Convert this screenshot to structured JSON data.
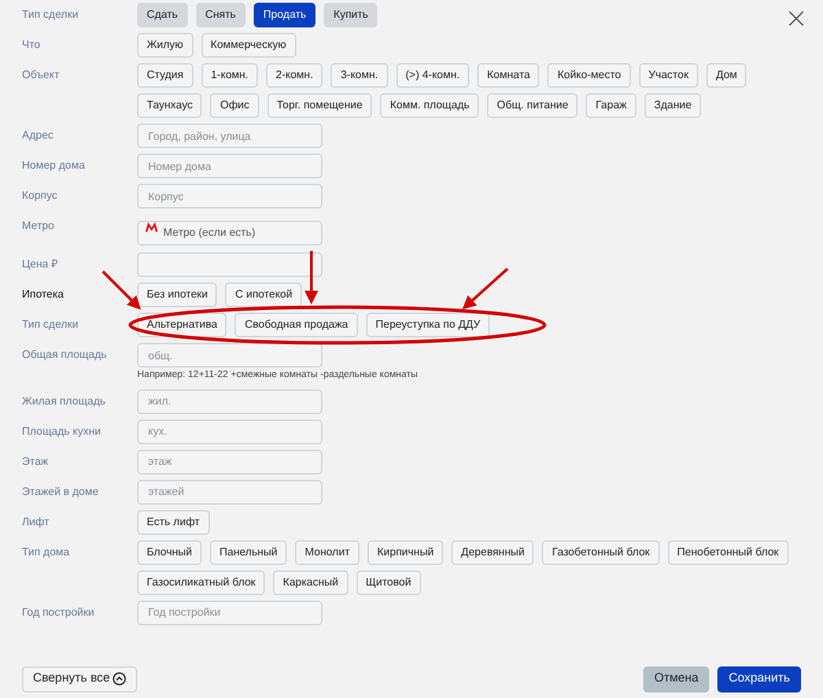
{
  "form": {
    "rows": [
      {
        "kind": "segmented",
        "label": "Тип сделки",
        "label_active": false,
        "options": [
          {
            "label": "Сдать",
            "selected": false
          },
          {
            "label": "Снять",
            "selected": false
          },
          {
            "label": "Продать",
            "selected": true
          },
          {
            "label": "Купить",
            "selected": false
          }
        ]
      },
      {
        "kind": "options",
        "label": "Что",
        "label_active": false,
        "options": [
          {
            "label": "Жилую",
            "selected": false
          },
          {
            "label": "Коммерческую",
            "selected": false
          }
        ]
      },
      {
        "kind": "options",
        "label": "Объект",
        "label_active": false,
        "options": [
          {
            "label": "Студия",
            "selected": false
          },
          {
            "label": "1-комн.",
            "selected": false
          },
          {
            "label": "2-комн.",
            "selected": false
          },
          {
            "label": "3-комн.",
            "selected": false
          },
          {
            "label": "(>) 4-комн.",
            "selected": false
          },
          {
            "label": "Комната",
            "selected": false
          },
          {
            "label": "Койко-место",
            "selected": false
          },
          {
            "label": "Участок",
            "selected": false
          },
          {
            "label": "Дом",
            "selected": false
          },
          {
            "label": "Таунхаус",
            "selected": false
          },
          {
            "label": "Офис",
            "selected": false
          },
          {
            "label": "Торг. помещение",
            "selected": false
          },
          {
            "label": "Комм. площадь",
            "selected": false
          },
          {
            "label": "Общ. питание",
            "selected": false
          },
          {
            "label": "Гараж",
            "selected": false
          },
          {
            "label": "Здание",
            "selected": false
          }
        ]
      },
      {
        "kind": "input",
        "label": "Адрес",
        "label_active": false,
        "placeholder": "Город, район, улица"
      },
      {
        "kind": "input",
        "label": "Номер дома",
        "label_active": false,
        "placeholder": "Номер дома"
      },
      {
        "kind": "input",
        "label": "Корпус",
        "label_active": false,
        "placeholder": "Корпус"
      },
      {
        "kind": "metro",
        "label": "Метро",
        "label_active": false,
        "placeholder": "Метро (если есть)"
      },
      {
        "kind": "input",
        "label": "Цена ₽",
        "label_active": false
      },
      {
        "kind": "options",
        "label": "Ипотека",
        "label_active": true,
        "options": [
          {
            "label": "Без ипотеки",
            "selected": false
          },
          {
            "label": "С ипотекой",
            "selected": false
          }
        ]
      },
      {
        "kind": "callout",
        "label": "Тип сделки",
        "label_active": false,
        "options": [
          {
            "label": "Альтернатива",
            "selected": false
          },
          {
            "label": "Свободная продажа",
            "selected": false
          },
          {
            "label": "Переуступка по ДДУ",
            "selected": false
          }
        ]
      },
      {
        "kind": "input",
        "label": "Общая площадь",
        "label_active": false,
        "placeholder": "общ.",
        "hint": "Например: 12+11-22 +смежные комнаты -раздельные комнаты"
      },
      {
        "kind": "input",
        "label": "Жилая площадь",
        "label_active": false,
        "placeholder": "жил."
      },
      {
        "kind": "input",
        "label": "Площадь кухни",
        "label_active": false,
        "placeholder": "кух."
      },
      {
        "kind": "input",
        "label": "Этаж",
        "label_active": false,
        "placeholder": "этаж"
      },
      {
        "kind": "input",
        "label": "Этажей в доме",
        "label_active": false,
        "placeholder": "этажей"
      },
      {
        "kind": "options",
        "label": "Лифт",
        "label_active": false,
        "options": [
          {
            "label": "Есть лифт",
            "selected": false
          }
        ]
      },
      {
        "kind": "options",
        "label": "Тип дома",
        "label_active": false,
        "options": [
          {
            "label": "Блочный",
            "selected": false
          },
          {
            "label": "Панельный",
            "selected": false
          },
          {
            "label": "Монолит",
            "selected": false
          },
          {
            "label": "Кирпичный",
            "selected": false
          },
          {
            "label": "Деревянный",
            "selected": false
          },
          {
            "label": "Газобетонный блок",
            "selected": false
          },
          {
            "label": "Пенобетонный блок",
            "selected": false
          },
          {
            "label": "Газосиликатный блок",
            "selected": false
          },
          {
            "label": "Каркасный",
            "selected": false
          },
          {
            "label": "Щитовой",
            "selected": false
          }
        ]
      },
      {
        "kind": "input",
        "label": "Год постройки",
        "label_active": false,
        "placeholder": "Год постройки"
      }
    ]
  },
  "footer": {
    "collapse": "Свернуть все",
    "cancel": "Отмена",
    "save": "Сохранить"
  }
}
